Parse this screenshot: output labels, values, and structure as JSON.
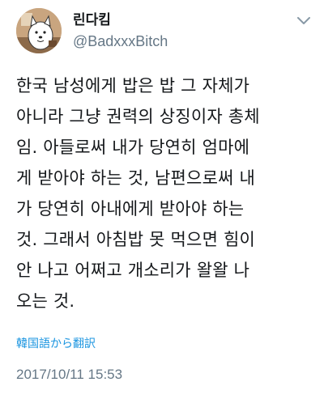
{
  "user": {
    "display_name": "린다킴",
    "handle": "@BadxxxBitch",
    "avatar_icon": "cartoon-dog-avatar"
  },
  "menu": {
    "caret_icon": "chevron-down-icon"
  },
  "tweet": {
    "lines": [
      "한국 남성에게 밥은 밥 그 자체가",
      "아니라 그냥 권력의 상징이자 총체",
      "임. 아들로써 내가 당연히 엄마에",
      "게 받아야 하는 것, 남편으로써 내",
      "가 당연히 아내에게 받아야 하는",
      "것. 그래서 아침밥 못 먹으면 힘이",
      "안 나고 어쩌고 개소리가 왈왈 나",
      "오는 것."
    ],
    "translate_label": "韓国語から翻訳",
    "timestamp": "2017/10/11 15:53"
  },
  "colors": {
    "text": "#14171a",
    "secondary": "#657786",
    "link": "#1b95e0"
  }
}
